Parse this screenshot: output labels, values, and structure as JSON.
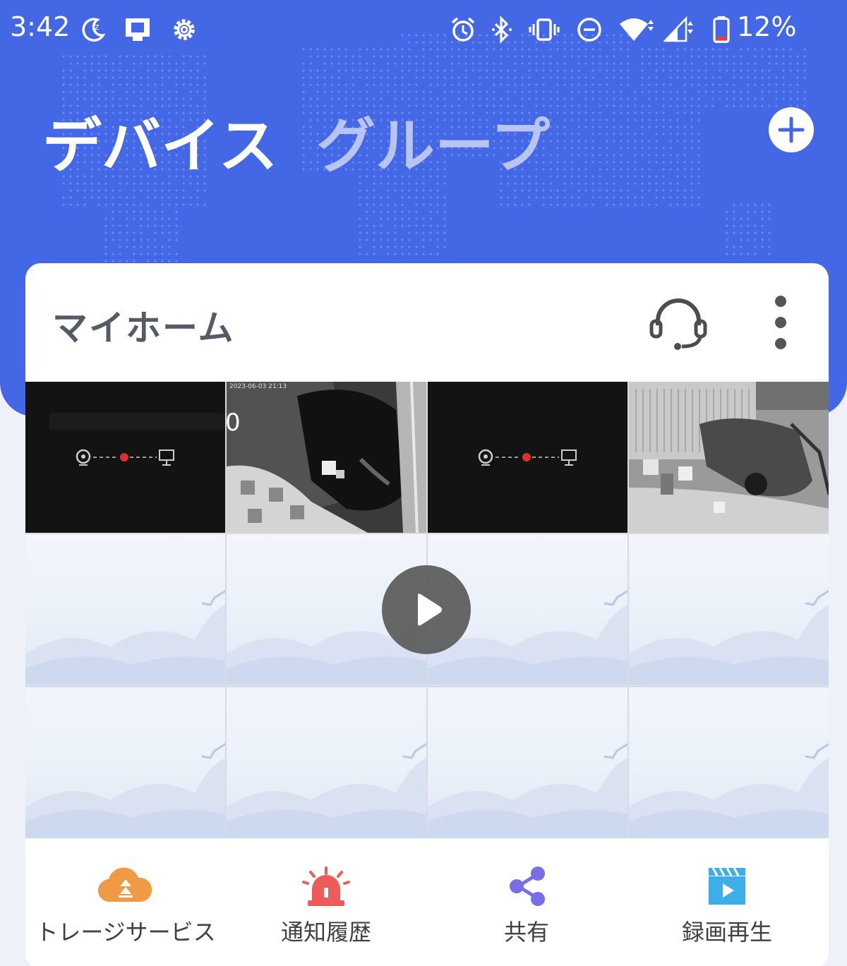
{
  "status_bar": {
    "time": "3:42",
    "battery_percent": "12%",
    "icons_left": [
      "moon-icon",
      "cast-icon",
      "settings-icon"
    ],
    "icons_right": [
      "alarm-icon",
      "bluetooth-icon",
      "vibrate-icon",
      "dnd-icon",
      "wifi-icon",
      "signal-icon",
      "battery-icon"
    ]
  },
  "header": {
    "tabs": [
      {
        "label": "デバイス",
        "active": true
      },
      {
        "label": "グループ",
        "active": false
      }
    ],
    "add_icon": "plus-icon",
    "background_color": "#4467e6"
  },
  "card": {
    "title": "マイホーム",
    "support_icon": "headset-icon",
    "more_icon": "more-vertical-icon",
    "grid": {
      "rows": 3,
      "columns": 4,
      "cells": [
        {
          "state": "disconnected"
        },
        {
          "state": "camera-feed",
          "overlay": "0"
        },
        {
          "state": "disconnected"
        },
        {
          "state": "camera-feed"
        },
        {
          "state": "empty"
        },
        {
          "state": "empty"
        },
        {
          "state": "empty"
        },
        {
          "state": "empty"
        },
        {
          "state": "empty"
        },
        {
          "state": "empty"
        },
        {
          "state": "empty"
        },
        {
          "state": "empty"
        }
      ]
    },
    "play_icon": "play-icon"
  },
  "bottom_nav": [
    {
      "label": "トレージサービス",
      "icon": "cloud-storage-icon",
      "color": "#f19a45"
    },
    {
      "label": "通知履歴",
      "icon": "alarm-light-icon",
      "color": "#ee5b5b"
    },
    {
      "label": "共有",
      "icon": "share-icon",
      "color": "#7a6ee6"
    },
    {
      "label": "録画再生",
      "icon": "video-playback-icon",
      "color": "#3daee8"
    }
  ]
}
